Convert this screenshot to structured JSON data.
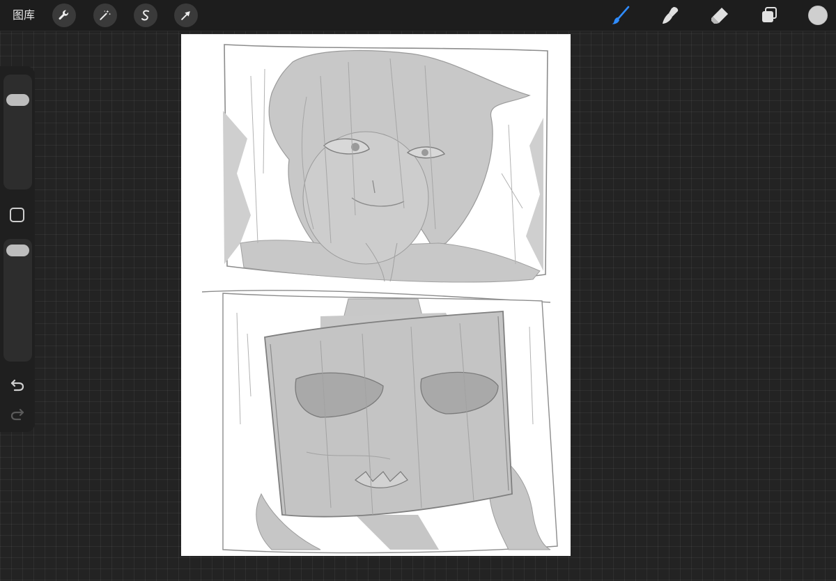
{
  "topbar": {
    "gallery_label": "图库",
    "adjust_tools": [
      {
        "name": "actions",
        "icon": "wrench-icon"
      },
      {
        "name": "adjustments",
        "icon": "magic-wand-icon"
      },
      {
        "name": "selection",
        "icon": "selection-s-icon"
      },
      {
        "name": "transform",
        "icon": "arrow-cursor-icon"
      }
    ],
    "draw_tools": [
      {
        "name": "brush",
        "icon": "brush-icon",
        "active": true
      },
      {
        "name": "smudge",
        "icon": "smudge-icon",
        "active": false
      },
      {
        "name": "eraser",
        "icon": "eraser-icon",
        "active": false
      },
      {
        "name": "layers",
        "icon": "layers-icon",
        "active": false
      }
    ],
    "current_color": "#cfcfcf"
  },
  "sidebar": {
    "brush_size": {
      "icon": "size-slider"
    },
    "opacity": {
      "icon": "opacity-slider"
    },
    "modify": {
      "icon": "square-icon"
    },
    "undo": {
      "icon": "undo-arrow-icon"
    },
    "redo": {
      "icon": "redo-arrow-icon",
      "enabled": false
    }
  },
  "colors": {
    "accent": "#2f8cff",
    "toolbar_bg": "#1d1d1d",
    "canvas_bg": "#ffffff",
    "sketch_fill": "#c9c9c9",
    "sketch_line": "#8a8a8a"
  }
}
